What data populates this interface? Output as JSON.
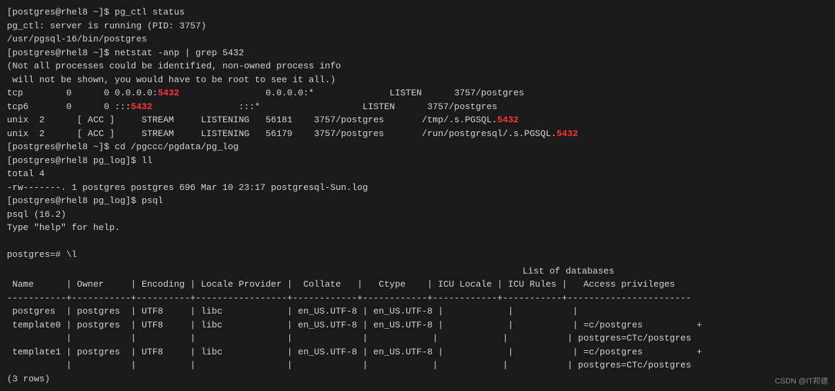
{
  "terminal": {
    "lines": [
      {
        "id": "l1",
        "text": "[postgres@rhel8 ~]$ pg_ctl status",
        "parts": [
          {
            "text": "[postgres@rhel8 ~]$ pg_ctl status",
            "color": "white"
          }
        ]
      },
      {
        "id": "l2",
        "text": "pg_ctl: server is running (PID: 3757)",
        "parts": [
          {
            "text": "pg_ctl: server is running (PID: 3757)",
            "color": "white"
          }
        ]
      },
      {
        "id": "l3",
        "text": "/usr/pgsql-16/bin/postgres",
        "parts": [
          {
            "text": "/usr/pgsql-16/bin/postgres",
            "color": "white"
          }
        ]
      },
      {
        "id": "l4",
        "text": "[postgres@rhel8 ~]$ netstat -anp | grep 5432",
        "parts": [
          {
            "text": "[postgres@rhel8 ~]$ netstat -anp | grep 5432",
            "color": "white"
          }
        ]
      },
      {
        "id": "l5",
        "text": "(Not all processes could be identified, non-owned process info",
        "parts": [
          {
            "text": "(Not all processes could be identified, non-owned process info",
            "color": "white"
          }
        ]
      },
      {
        "id": "l6",
        "text": " will not be shown, you would have to be root to see it all.)",
        "parts": [
          {
            "text": " will not be shown, you would have to be root to see it all.)",
            "color": "white"
          }
        ]
      },
      {
        "id": "l7",
        "parts": [
          {
            "text": "tcp        0      0 0.0.0.0:",
            "color": "white"
          },
          {
            "text": "5432",
            "color": "red"
          },
          {
            "text": "                0.0.0.0:*              LISTEN      3757/postgres",
            "color": "white"
          }
        ]
      },
      {
        "id": "l8",
        "parts": [
          {
            "text": "tcp6       0      0 :::",
            "color": "white"
          },
          {
            "text": "5432",
            "color": "red"
          },
          {
            "text": "                :::*                   LISTEN      3757/postgres",
            "color": "white"
          }
        ]
      },
      {
        "id": "l9",
        "parts": [
          {
            "text": "unix  2      [ ACC ]     STREAM     LISTENING   56181    3757/postgres       /tmp/.s.PGSQL.",
            "color": "white"
          },
          {
            "text": "5432",
            "color": "red"
          }
        ]
      },
      {
        "id": "l10",
        "parts": [
          {
            "text": "unix  2      [ ACC ]     STREAM     LISTENING   56179    3757/postgres       /run/postgresql/.s.PGSQL.",
            "color": "white"
          },
          {
            "text": "5432",
            "color": "red"
          }
        ]
      },
      {
        "id": "l11",
        "text": "[postgres@rhel8 ~]$ cd /pgccc/pgdata/pg_log",
        "parts": [
          {
            "text": "[postgres@rhel8 ~]$ cd /pgccc/pgdata/pg_log",
            "color": "white"
          }
        ]
      },
      {
        "id": "l12",
        "text": "[postgres@rhel8 pg_log]$ ll",
        "parts": [
          {
            "text": "[postgres@rhel8 pg_log]$ ll",
            "color": "white"
          }
        ]
      },
      {
        "id": "l13",
        "text": "total 4",
        "parts": [
          {
            "text": "total 4",
            "color": "white"
          }
        ]
      },
      {
        "id": "l14",
        "text": "-rw-------. 1 postgres postgres 696 Mar 10 23:17 postgresql-Sun.log",
        "parts": [
          {
            "text": "-rw-------. 1 postgres postgres 696 Mar 10 23:17 postgresql-Sun.log",
            "color": "white"
          }
        ]
      },
      {
        "id": "l15",
        "text": "[postgres@rhel8 pg_log]$ psql",
        "parts": [
          {
            "text": "[postgres@rhel8 pg_log]$ psql",
            "color": "white"
          }
        ]
      },
      {
        "id": "l16",
        "text": "psql (16.2)",
        "parts": [
          {
            "text": "psql (16.2)",
            "color": "white"
          }
        ]
      },
      {
        "id": "l17",
        "text": "Type \"help\" for help.",
        "parts": [
          {
            "text": "Type \"help\" for help.",
            "color": "white"
          }
        ]
      },
      {
        "id": "l18",
        "text": "",
        "parts": []
      },
      {
        "id": "l19",
        "text": "postgres=# \\l",
        "parts": [
          {
            "text": "postgres=# \\l",
            "color": "white"
          }
        ]
      }
    ],
    "table": {
      "title": "                                                        List of databases",
      "header": " Name      | Owner     | Encoding | Locale Provider |  Collate   |   Ctype    | ICU Locale | ICU Rules |   Access privileges   ",
      "separator": "-----------+-----------+----------+-----------------+------------+------------+------------+-----------+-----------------------",
      "rows": [
        " postgres  | postgres  | UTF8     | libc            | en_US.UTF-8 | en_US.UTF-8 |            |           |",
        " template0 | postgres  | UTF8     | libc            | en_US.UTF-8 | en_US.UTF-8 |            |           | =c/postgres          +",
        "           |           |          |                 |             |            |            |           | postgres=CTc/postgres",
        " template1 | postgres  | UTF8     | libc            | en_US.UTF-8 | en_US.UTF-8 |            |           | =c/postgres          +",
        "           |           |          |                 |             |            |            |           | postgres=CTc/postgres"
      ],
      "footer": "(3 rows)"
    },
    "watermark": "CSDN @IT邦德"
  }
}
